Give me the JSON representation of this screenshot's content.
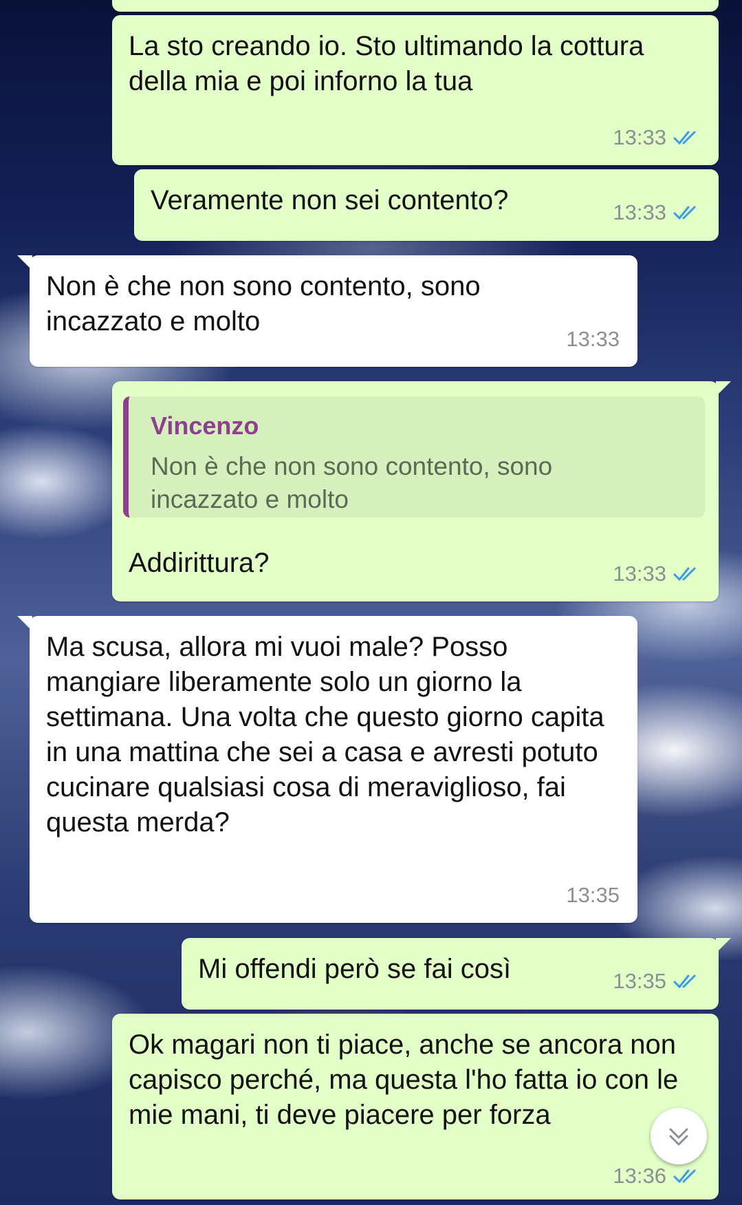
{
  "messages": [
    {
      "direction": "out",
      "text": "",
      "time": ""
    },
    {
      "direction": "out",
      "text": "La sto creando io. Sto ultimando la cottura della mia e poi inforno la tua",
      "time": "13:33",
      "status": "read"
    },
    {
      "direction": "out",
      "text": "Veramente non sei contento?",
      "time": "13:33",
      "status": "read"
    },
    {
      "direction": "in",
      "text": "Non è che non sono contento, sono incazzato e molto",
      "time": "13:33"
    },
    {
      "direction": "out",
      "quote": {
        "author": "Vincenzo",
        "text": "Non è che non sono contento, sono incazzato e molto"
      },
      "text": "Addirittura?",
      "time": "13:33",
      "status": "read"
    },
    {
      "direction": "in",
      "text": "Ma scusa, allora mi vuoi male? Posso mangiare liberamente solo un giorno la settimana. Una volta che questo giorno capita in una mattina che sei a casa e avresti potuto cucinare qualsiasi cosa di meraviglioso, fai questa merda?",
      "time": "13:35"
    },
    {
      "direction": "out",
      "text": "Mi offendi però se fai così",
      "time": "13:35",
      "status": "read"
    },
    {
      "direction": "out",
      "text": "Ok magari non ti piace, anche se ancora non capisco perché, ma questa l'ho fatta io con le mie mani, ti deve piacere per forza",
      "time": "13:36",
      "status": "read"
    }
  ],
  "icons": {
    "read_ticks": "double-check-icon",
    "scroll_down": "chevron-down-icon"
  },
  "colors": {
    "outgoing_bubble": "#e2ffc7",
    "incoming_bubble": "#ffffff",
    "read_ticks": "#3a9be8",
    "quote_accent": "#8e3f8f",
    "timestamp": "#8a8f93"
  }
}
